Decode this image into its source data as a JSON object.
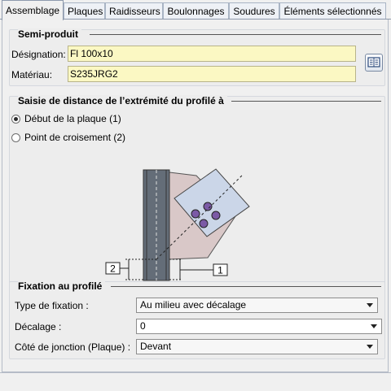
{
  "tabs": [
    "Assemblage",
    "Plaques",
    "Raidisseurs",
    "Boulonnages",
    "Soudures",
    "Éléments sélectionnés"
  ],
  "semi_produit": {
    "title": "Semi-produit",
    "designation_label": "Désignation:",
    "designation_value": "Fl 100x10",
    "materiau_label": "Matériau:",
    "materiau_value": "S235JRG2",
    "catalog_icon": "book-catalog-icon"
  },
  "saisie": {
    "title": "Saisie de distance de l’extrémité du profilé à",
    "options": [
      "Début de la plaque (1)",
      "Point de croisement (2)"
    ],
    "selected": 0,
    "diagram_labels": [
      "2",
      "1"
    ]
  },
  "fixation": {
    "title": "Fixation au profilé",
    "type_label": "Type de fixation :",
    "type_value": "Au milieu avec décalage",
    "decalage_label": "Décalage :",
    "decalage_value": "0",
    "cote_label": "Côté de jonction (Plaque) :",
    "cote_value": "Devant"
  },
  "colors": {
    "field_bg": "#fbf8c3",
    "bolt": "#7b5aa6",
    "plate": "#cbd6e8",
    "gusset": "#d9c8c8",
    "profile": "#646d78"
  }
}
